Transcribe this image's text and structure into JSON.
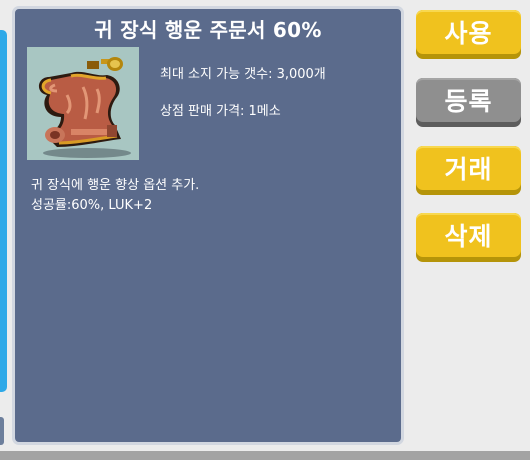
{
  "item": {
    "name": "귀 장식 행운 주문서 60%",
    "icon": "scroll-icon",
    "max_hold": "최대 소지 가능 갯수: 3,000개",
    "shop_price": "상점 판매 가격: 1메소",
    "description": "귀 장식에 행운 향상 옵션 추가.",
    "stats": "성공률:60%, LUK+2"
  },
  "actions": {
    "use_label": "사용",
    "register_label": "등록",
    "trade_label": "거래",
    "delete_label": "삭제"
  },
  "colors": {
    "panel": "#5b6b8c",
    "panel_border": "#d2d7e0",
    "button_yellow": "#f0c21e",
    "button_gray": "#8f8f8f",
    "icon_background": "#a8c6c2",
    "side_strip": "#2ea9e8"
  }
}
